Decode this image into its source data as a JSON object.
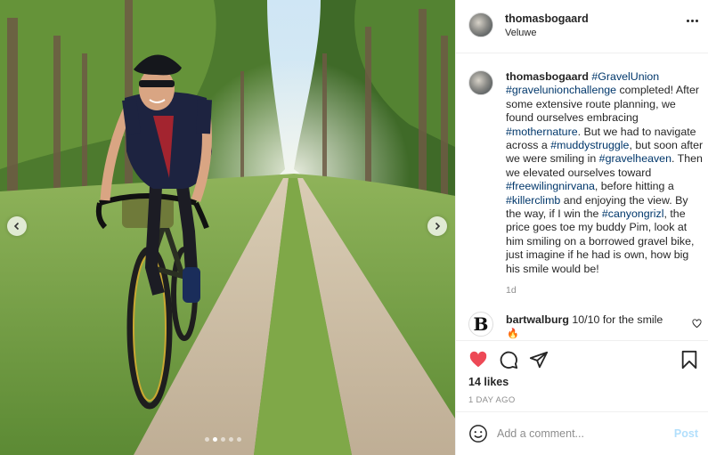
{
  "post": {
    "username": "thomasbogaard",
    "location": "Veluwe",
    "caption_parts": [
      {
        "t": "#GravelUnion",
        "tag": true
      },
      {
        "t": " ",
        "tag": false
      },
      {
        "t": "#gravelunionchallenge",
        "tag": true
      },
      {
        "t": " completed! After some extensive route planning, we found ourselves embracing ",
        "tag": false
      },
      {
        "t": "#mothernature",
        "tag": true
      },
      {
        "t": ". But we had to navigate across a ",
        "tag": false
      },
      {
        "t": "#muddystruggle",
        "tag": true
      },
      {
        "t": ", but soon after we were smiling in ",
        "tag": false
      },
      {
        "t": "#gravelheaven",
        "tag": true
      },
      {
        "t": ". Then we elevated ourselves toward ",
        "tag": false
      },
      {
        "t": "#freewilingnirvana",
        "tag": true
      },
      {
        "t": ", before hitting a ",
        "tag": false
      },
      {
        "t": "#killerclimb",
        "tag": true
      },
      {
        "t": " and enjoying the view. By the way, if I win the ",
        "tag": false
      },
      {
        "t": "#canyongrizl",
        "tag": true
      },
      {
        "t": ", the price goes toe my buddy Pim, look at him smiling on a borrowed gravel bike, just imagine if he had is own, how big his smile would be!",
        "tag": false
      }
    ],
    "caption_time": "1d",
    "likes": "14 likes",
    "posted": "1 DAY AGO"
  },
  "comment": {
    "avatar_letter": "B",
    "username": "bartwalburg",
    "text": "10/10 for the smile",
    "emoji": "🔥"
  },
  "add_comment": {
    "placeholder": "Add a comment...",
    "post_label": "Post"
  },
  "carousel": {
    "dot_count": 5,
    "active_index": 1
  },
  "icons": {
    "more": "more-options-icon",
    "like": "heart-filled-icon",
    "comment": "comment-bubble-icon",
    "share": "paper-plane-icon",
    "save": "bookmark-icon",
    "emoji": "smiley-icon",
    "prev": "chevron-left-icon",
    "next": "chevron-right-icon"
  },
  "colors": {
    "like": "#ed4956",
    "hashtag": "#00376b",
    "post_button": "#b2dffc",
    "muted": "#8e8e8e"
  }
}
